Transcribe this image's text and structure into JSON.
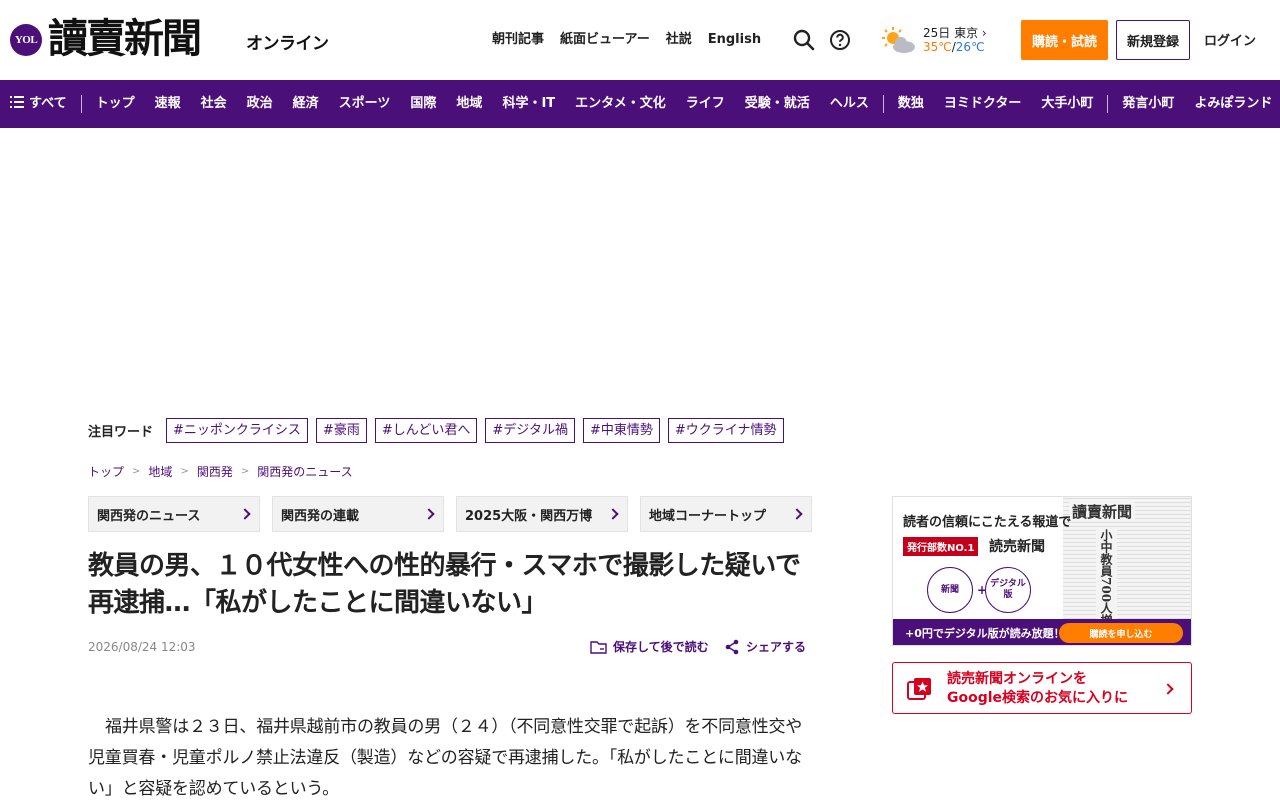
{
  "header": {
    "logo_badge": "YOL",
    "logo_text": "讀賣新聞",
    "logo_sub": "オンライン",
    "links": [
      "朝刊記事",
      "紙面ビューアー",
      "社説",
      "English"
    ],
    "weather": {
      "date_city": "25日 東京",
      "high": "35℃",
      "divider": "/",
      "low": "26℃",
      "icon": "sun-cloud-icon"
    },
    "subscribe_label": "購読・試読",
    "register_label": "新規登録",
    "login_label": "ログイン"
  },
  "nav": {
    "all_label": "すべて",
    "items": [
      "トップ",
      "速報",
      "社会",
      "政治",
      "経済",
      "スポーツ",
      "国際",
      "地域",
      "科学・IT",
      "エンタメ・文化",
      "ライフ",
      "受験・就活",
      "ヘルス"
    ],
    "extra_items": [
      "数独",
      "ヨミドクター",
      "大手小町"
    ],
    "last_items": [
      "発言小町",
      "よみぽランド"
    ]
  },
  "attention": {
    "label": "注目ワード",
    "tags": [
      "#ニッポンクライシス",
      "#豪雨",
      "#しんどい君へ",
      "#デジタル禍",
      "#中東情勢",
      "#ウクライナ情勢"
    ]
  },
  "breadcrumb": [
    "トップ",
    "地域",
    "関西発",
    "関西発のニュース"
  ],
  "section_tabs": [
    "関西発のニュース",
    "関西発の連載",
    "2025大阪・関西万博",
    "地域コーナートップ"
  ],
  "article": {
    "title": "教員の男、１０代女性への性的暴行・スマホで撮影した疑いで再逮捕…「私がしたことに間違いない」",
    "date": "2026/08/24 12:03",
    "save_label": "保存して後で読む",
    "share_label": "シェアする",
    "body": "福井県警は２３日、福井県越前市の教員の男（２４）（不同意性交罪で起訴）を不同意性交や児童買春・児童ポルノ禁止法違反（製造）などの容疑で再逮捕した。「私がしたことに間違いない」と容疑を認めているという。"
  },
  "side_ad": {
    "headline": "読者の信頼にこたえる報道で",
    "badge": "発行部数NO.1",
    "brand": "読売新聞",
    "circle1": "新聞",
    "circle2": "デジタル版",
    "plus": "+",
    "paper_title": "讀賣新聞",
    "paper_headline": "小中教員700人増",
    "footer_text": "+0円でデジタル版が読み放題！",
    "cta": "購読を申し込む"
  },
  "google_box": {
    "line1": "読売新聞オンラインを",
    "line2": "Google検索のお気に入りに"
  },
  "colors": {
    "brand_purple": "#4b0f7a",
    "accent_orange": "#ff7e00",
    "alert_red": "#d7001e"
  }
}
